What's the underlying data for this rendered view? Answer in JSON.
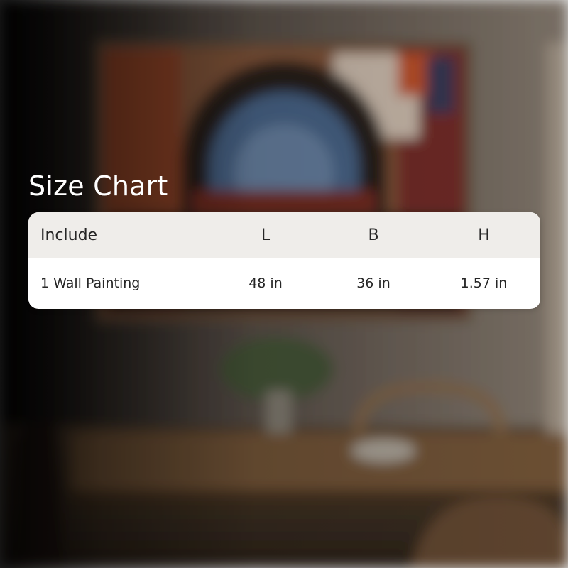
{
  "title": "Size Chart",
  "table": {
    "columns": [
      "Include",
      "L",
      "B",
      "H"
    ],
    "rows": [
      [
        "1 Wall Painting",
        "48 in",
        "36 in",
        "1.57 in"
      ]
    ]
  },
  "colors": {
    "header_bg": "#efedea",
    "row_bg": "#ffffff",
    "text": "#262626",
    "title": "#ffffff"
  }
}
